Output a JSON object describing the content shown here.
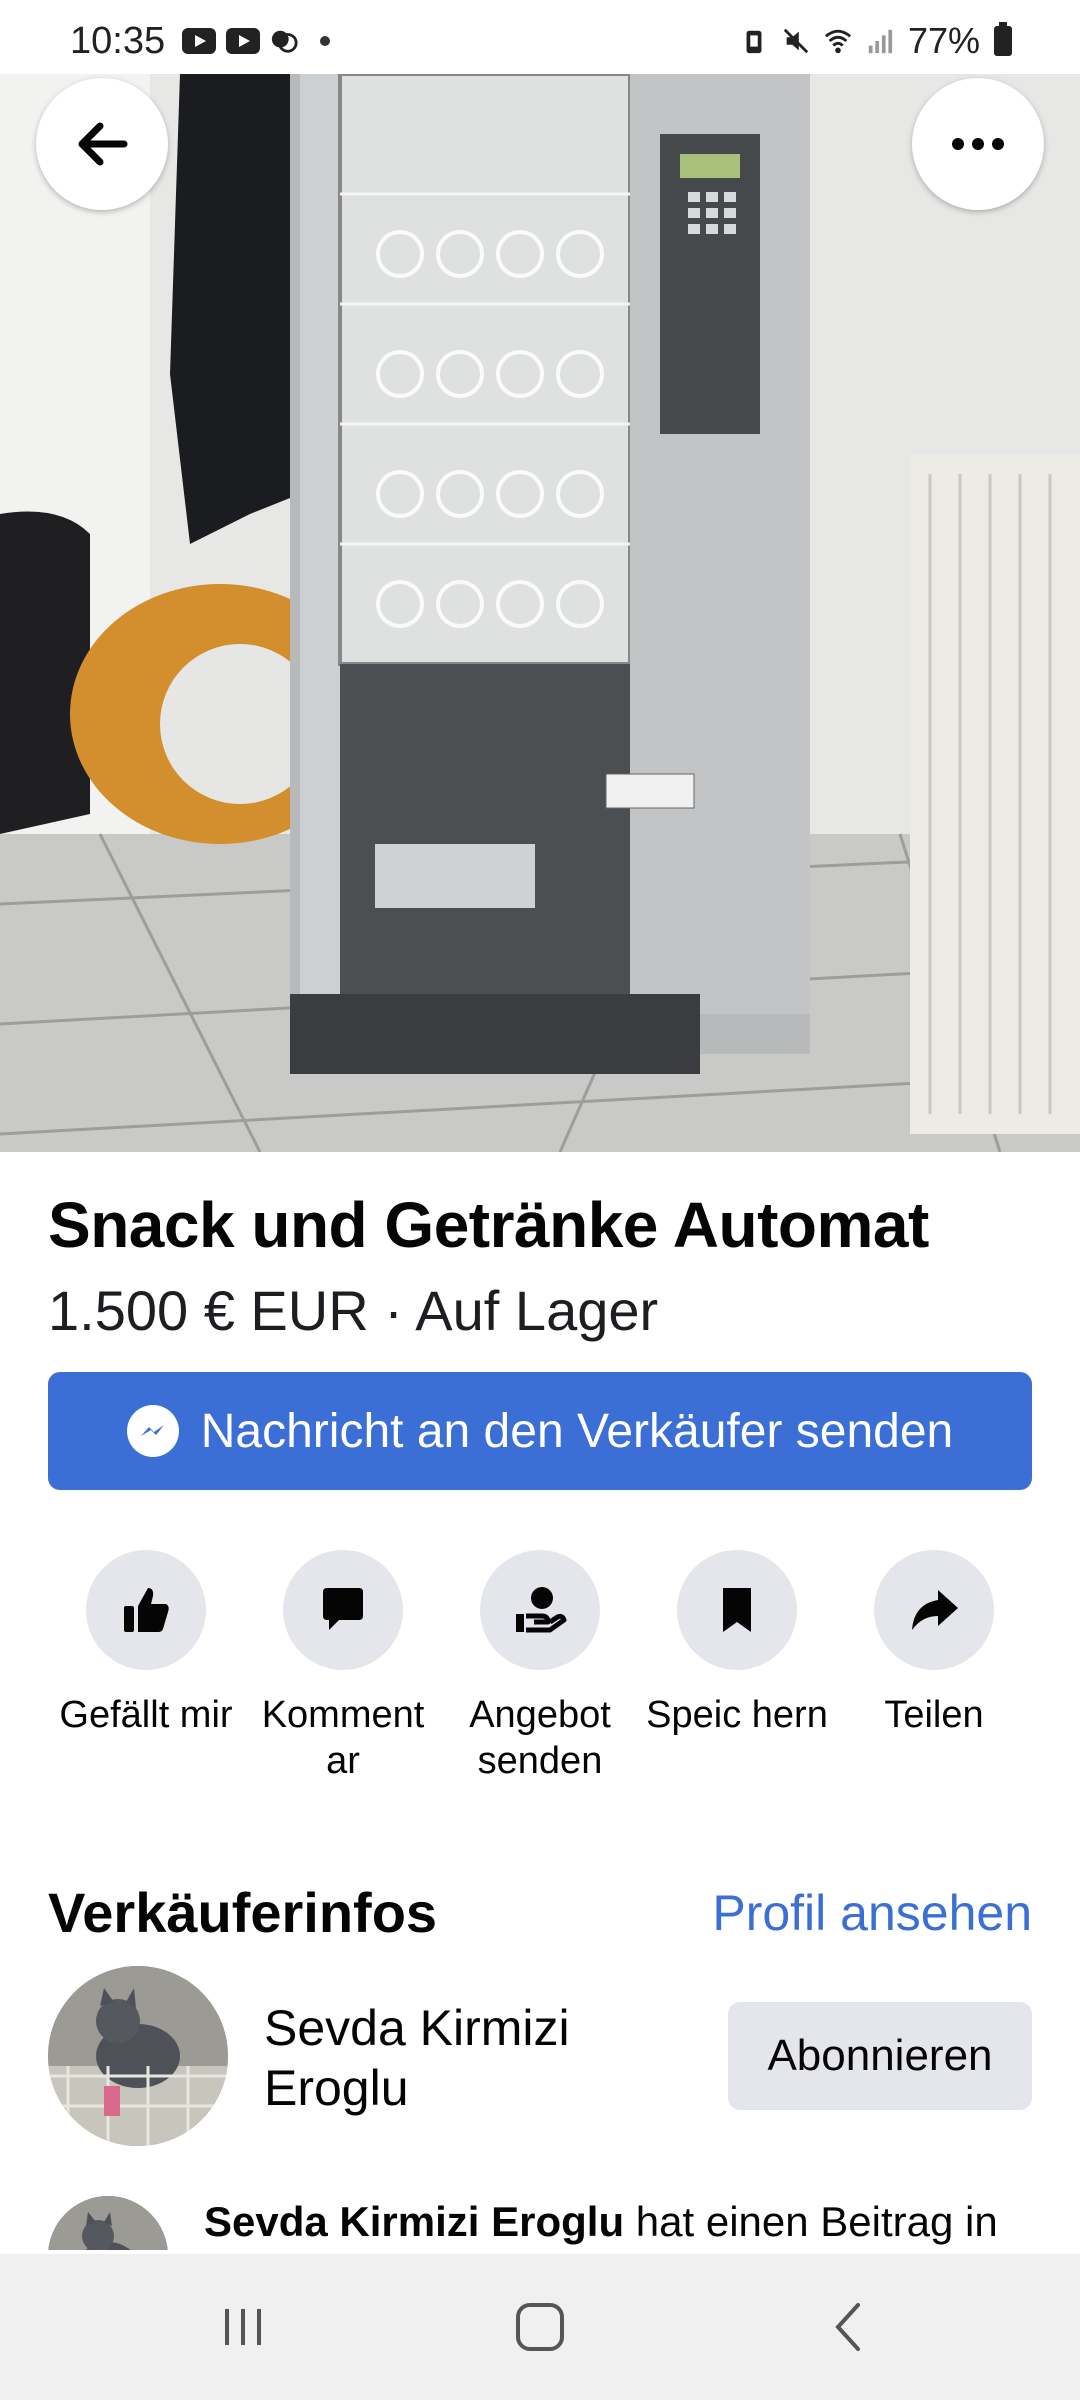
{
  "status_bar": {
    "time": "10:35",
    "battery": "77%",
    "left_icons": [
      "youtube-icon",
      "youtube-icon",
      "call-icon",
      "dot"
    ],
    "right_icons": [
      "battery-saver-icon",
      "mute-icon",
      "wifi-icon",
      "signal-icon",
      "battery-icon"
    ]
  },
  "hero": {
    "back_icon": "arrow-left-icon",
    "more_icon": "more-horizontal-icon"
  },
  "listing": {
    "title": "Snack und Getränke Automat",
    "price_line": "1.500 € EUR · Auf Lager",
    "message_button": "Nachricht an den Verkäufer senden"
  },
  "actions": [
    {
      "label": "Gefällt mir",
      "icon": "thumbs-up-icon"
    },
    {
      "label": "Komment ar",
      "icon": "comment-icon"
    },
    {
      "label": "Angebot senden",
      "icon": "offer-icon"
    },
    {
      "label": "Speic hern",
      "icon": "bookmark-icon"
    },
    {
      "label": "Teilen",
      "icon": "share-icon"
    }
  ],
  "seller": {
    "heading": "Verkäuferinfos",
    "profile_link": "Profil ansehen",
    "name": "Sevda Kirmizi Eroglu",
    "follow_button": "Abonnieren"
  },
  "post": {
    "author": "Sevda Kirmizi Eroglu",
    "text": " hat einen Beitrag in"
  },
  "colors": {
    "accent": "#3b6fd6",
    "chip_bg": "#e4e6eb",
    "text": "#050505"
  }
}
